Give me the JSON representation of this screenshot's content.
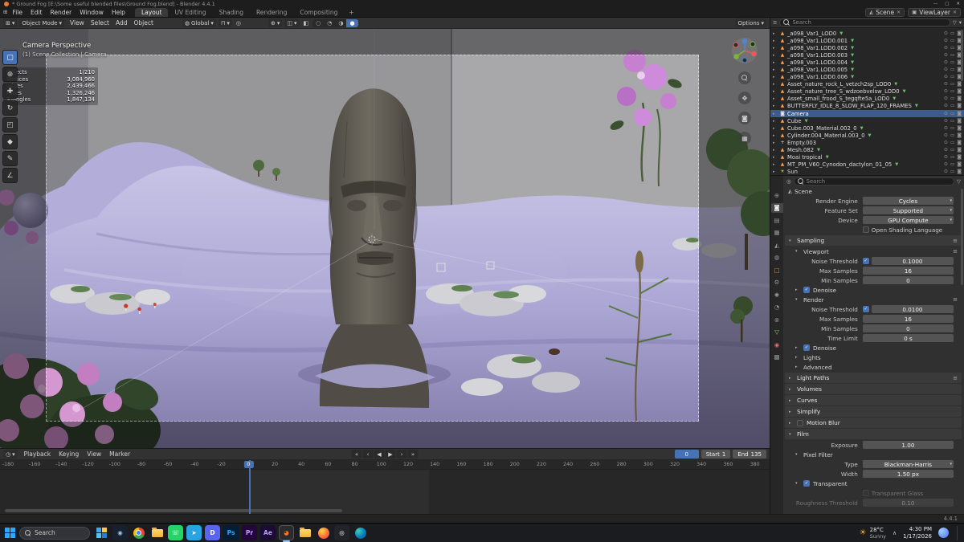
{
  "window": {
    "title": "* Ground Fog [E:\\Some useful blended files\\Ground Fog.blend] - Blender 4.4.1"
  },
  "icons": {
    "minimize": "—",
    "maximize": "▢",
    "close": "✕",
    "dropdown": "▾",
    "caret_right": "▸",
    "caret_down": "▾",
    "x_small": "✕",
    "check": "✓",
    "burger": "≡",
    "mesh_data": "▼",
    "grid": "⊞",
    "clock": "◷",
    "globe": "◍",
    "magnet": "⊓",
    "prop_circle": "◎",
    "gizmo": "⊕",
    "overlay": "◫",
    "xray": "◧",
    "shade_wire": "○",
    "shade_solid": "◔",
    "shade_mat": "◑",
    "shade_render": "●",
    "camera_small": "◙",
    "eye": "⊙",
    "monitor": "▭",
    "scene": "◭",
    "image": "▣",
    "sun": "☀",
    "funnel": "▽",
    "pan": "✥",
    "persp": "▦",
    "chev_up": "∧"
  },
  "topbar": {
    "menus": [
      "File",
      "Edit",
      "Render",
      "Window",
      "Help"
    ],
    "workspaces": [
      "Layout",
      "UV Editing",
      "Shading",
      "Rendering",
      "Compositing"
    ],
    "active_workspace": "Layout",
    "add_tab": "+",
    "scene_name": "Scene",
    "viewlayer_name": "ViewLayer"
  },
  "viewport": {
    "mode": "Object Mode",
    "menus": [
      "View",
      "Select",
      "Add",
      "Object"
    ],
    "orientation": "Global",
    "options_label": "Options",
    "view_name": "Camera Perspective",
    "context_line": "(1) Scene Collection | Camera",
    "stats": [
      {
        "label": "Objects",
        "value": "1/210"
      },
      {
        "label": "Vertices",
        "value": "3,084,960"
      },
      {
        "label": "Edges",
        "value": "2,439,466"
      },
      {
        "label": "Faces",
        "value": "1,326,246"
      },
      {
        "label": "Triangles",
        "value": "1,847,134"
      }
    ],
    "tools": [
      {
        "name": "select-box-tool",
        "glyph": "▢",
        "active": true
      },
      {
        "name": "cursor-tool",
        "glyph": "⊕"
      },
      {
        "name": "move-tool",
        "glyph": "✚"
      },
      {
        "name": "rotate-tool",
        "glyph": "↻"
      },
      {
        "name": "scale-tool",
        "glyph": "◰"
      },
      {
        "name": "transform-tool",
        "glyph": "◆"
      },
      {
        "name": "annotate-tool",
        "glyph": "✎"
      },
      {
        "name": "measure-tool",
        "glyph": "∠"
      }
    ]
  },
  "outliner": {
    "search_placeholder": "Search",
    "items": [
      {
        "name": "_a098_Var1_LOD0",
        "type": "mesh"
      },
      {
        "name": "_a098_Var1.LOD0.001",
        "type": "mesh"
      },
      {
        "name": "_a098_Var1.LOD0.002",
        "type": "mesh"
      },
      {
        "name": "_a098_Var1.LOD0.003",
        "type": "mesh"
      },
      {
        "name": "_a098_Var1.LOD0.004",
        "type": "mesh"
      },
      {
        "name": "_a098_Var1.LOD0.005",
        "type": "mesh"
      },
      {
        "name": "_a098_Var1.LOD0.006",
        "type": "mesh"
      },
      {
        "name": "Asset_nature_rock_L_vetzch2sp_LOD0",
        "type": "mesh"
      },
      {
        "name": "Asset_nature_tree_S_wdzoebvelsw_LOD0",
        "type": "mesh"
      },
      {
        "name": "Asset_small_frood_S_tegqfte5a_LOD0",
        "type": "mesh"
      },
      {
        "name": "BUTTERFLY_IDLE_8_SLOW_FLAP_120_FRAMES",
        "type": "mesh"
      },
      {
        "name": "Camera",
        "type": "camera",
        "selected": true
      },
      {
        "name": "Cube",
        "type": "mesh"
      },
      {
        "name": "Cube.003_Material.002_0",
        "type": "mesh"
      },
      {
        "name": "Cylinder.004_Material.003_0",
        "type": "mesh"
      },
      {
        "name": "Empty.003",
        "type": "empty"
      },
      {
        "name": "Mesh.082",
        "type": "mesh"
      },
      {
        "name": "Moai tropical",
        "type": "mesh"
      },
      {
        "name": "MT_PM_V60_Cynodon_dactylon_01_05",
        "type": "mesh"
      },
      {
        "name": "Sun",
        "type": "light"
      }
    ]
  },
  "outliner_icons": {
    "mesh": "▲",
    "camera": "◙",
    "empty": "+",
    "light": "☀"
  },
  "properties": {
    "search_placeholder": "Search",
    "breadcrumb": "Scene",
    "tabs": [
      {
        "name": "tool",
        "glyph": "⊕"
      },
      {
        "name": "render",
        "glyph": "◙",
        "active": true
      },
      {
        "name": "output",
        "glyph": "▤"
      },
      {
        "name": "view-layer",
        "glyph": "▦"
      },
      {
        "name": "scene",
        "glyph": "◭"
      },
      {
        "name": "world",
        "glyph": "◍"
      },
      {
        "name": "object",
        "glyph": "▢",
        "color": "#e8883a"
      },
      {
        "name": "modifiers",
        "glyph": "⚙"
      },
      {
        "name": "particles",
        "glyph": "✱"
      },
      {
        "name": "physics",
        "glyph": "◔"
      },
      {
        "name": "constraints",
        "glyph": "⊗"
      },
      {
        "name": "object-data",
        "glyph": "▽",
        "color": "#8fce6a"
      },
      {
        "name": "material",
        "glyph": "◉",
        "color": "#e06a6a"
      },
      {
        "name": "texture",
        "glyph": "▩"
      }
    ],
    "rows": [
      {
        "t": "field",
        "label": "Render Engine",
        "value": "Cycles",
        "dd": true
      },
      {
        "t": "field",
        "label": "Feature Set",
        "value": "Supported",
        "dd": true
      },
      {
        "t": "field",
        "label": "Device",
        "value": "GPU Compute",
        "dd": true
      },
      {
        "t": "check",
        "label": "Open Shading Language",
        "on": false
      },
      {
        "t": "hdr",
        "label": "Sampling",
        "open": true,
        "burger": true
      },
      {
        "t": "sub",
        "label": "Viewport",
        "open": true,
        "burger": true
      },
      {
        "t": "field",
        "label": "Noise Threshold",
        "value": "0.1000",
        "chk": true
      },
      {
        "t": "field",
        "label": "Max Samples",
        "value": "16"
      },
      {
        "t": "field",
        "label": "Min Samples",
        "value": "0"
      },
      {
        "t": "sub",
        "label": "Denoise",
        "open": false,
        "chk": true,
        "chk_on": true
      },
      {
        "t": "sub",
        "label": "Render",
        "open": true,
        "burger": true
      },
      {
        "t": "field",
        "label": "Noise Threshold",
        "value": "0.0100",
        "chk": true
      },
      {
        "t": "field",
        "label": "Max Samples",
        "value": "16"
      },
      {
        "t": "field",
        "label": "Min Samples",
        "value": "0"
      },
      {
        "t": "field",
        "label": "Time Limit",
        "value": "0 s"
      },
      {
        "t": "sub",
        "label": "Denoise",
        "open": false,
        "chk": true,
        "chk_on": true
      },
      {
        "t": "sub",
        "label": "Lights",
        "open": false
      },
      {
        "t": "sub",
        "label": "Advanced",
        "open": false
      },
      {
        "t": "hdr",
        "label": "Light Paths",
        "open": false,
        "burger": true
      },
      {
        "t": "hdr",
        "label": "Volumes",
        "open": false
      },
      {
        "t": "hdr",
        "label": "Curves",
        "open": false
      },
      {
        "t": "hdr",
        "label": "Simplify",
        "open": false
      },
      {
        "t": "hdr",
        "label": "Motion Blur",
        "open": false,
        "chk": true,
        "chk_on": false
      },
      {
        "t": "hdr",
        "label": "Film",
        "open": true
      },
      {
        "t": "field",
        "label": "Exposure",
        "value": "1.00"
      },
      {
        "t": "sub",
        "label": "Pixel Filter",
        "open": true
      },
      {
        "t": "field",
        "label": "Type",
        "value": "Blackman-Harris",
        "dd": true
      },
      {
        "t": "field",
        "label": "Width",
        "value": "1.50 px"
      },
      {
        "t": "sub",
        "label": "Transparent",
        "open": true,
        "chk": true,
        "chk_on": true
      },
      {
        "t": "check",
        "label": "Transparent Glass",
        "on": false,
        "dim": true
      },
      {
        "t": "field",
        "label": "Roughness Threshold",
        "value": "0.10",
        "dim": true
      }
    ]
  },
  "timeline": {
    "menus": [
      "Playback",
      "Keying",
      "View",
      "Marker"
    ],
    "transport": [
      {
        "name": "jump-to-start-button",
        "glyph": "«"
      },
      {
        "name": "prev-keyframe-button",
        "glyph": "‹"
      },
      {
        "name": "play-reverse-button",
        "glyph": "◀"
      },
      {
        "name": "play-button",
        "glyph": "▶"
      },
      {
        "name": "next-keyframe-button",
        "glyph": "›"
      },
      {
        "name": "jump-to-end-button",
        "glyph": "»"
      }
    ],
    "ticks": [
      "-180",
      "-160",
      "-140",
      "-120",
      "-100",
      "-80",
      "-60",
      "-40",
      "-20",
      "0",
      "20",
      "40",
      "60",
      "80",
      "100",
      "120",
      "140",
      "160",
      "180",
      "200",
      "220",
      "240",
      "260",
      "280",
      "300",
      "320",
      "340",
      "360",
      "380"
    ],
    "current_frame": "0",
    "start_label": "Start",
    "start_value": "1",
    "end_label": "End",
    "end_value": "135"
  },
  "statusbar": {
    "version": "4.4.1"
  },
  "taskbar": {
    "search_placeholder": "Search",
    "apps": [
      {
        "name": "widgets",
        "style": "quad",
        "colors": [
          "#4aa3e8",
          "#f7c948",
          "#53c3f0",
          "#2b7cd3"
        ]
      },
      {
        "name": "steam",
        "bg": "#17202e",
        "glyph": "◉",
        "fg": "#9fc5e8"
      },
      {
        "name": "chrome",
        "style": "chrome"
      },
      {
        "name": "file-explorer",
        "style": "folder"
      },
      {
        "name": "whatsapp",
        "bg": "#25d366",
        "glyph": "☏",
        "fg": "#ffffff"
      },
      {
        "name": "telegram",
        "bg": "#2aa3e3",
        "glyph": "➤",
        "fg": "#ffffff"
      },
      {
        "name": "discord",
        "bg": "#5865f2",
        "glyph": "D",
        "fg": "#ffffff"
      },
      {
        "name": "photoshop",
        "bg": "#001e36",
        "glyph": "Ps",
        "fg": "#31a8ff"
      },
      {
        "name": "premiere",
        "bg": "#24053d",
        "glyph": "Pr",
        "fg": "#c9a0ff"
      },
      {
        "name": "after-effects",
        "bg": "#1c0b35",
        "glyph": "Ae",
        "fg": "#b6a0f5"
      },
      {
        "name": "blender",
        "bg": "#2b2b2b",
        "glyph": "◕",
        "fg": "#f5792a",
        "active": true
      },
      {
        "name": "folder",
        "style": "folder"
      },
      {
        "name": "firefox",
        "style": "firefox"
      },
      {
        "name": "obs",
        "bg": "#23242a",
        "glyph": "◎",
        "fg": "#ffffff"
      },
      {
        "name": "edge",
        "style": "edge"
      }
    ],
    "tray": {
      "temp": "28°C",
      "condition": "Sunny",
      "time": "4:30 PM",
      "date": "1/17/2026"
    }
  }
}
